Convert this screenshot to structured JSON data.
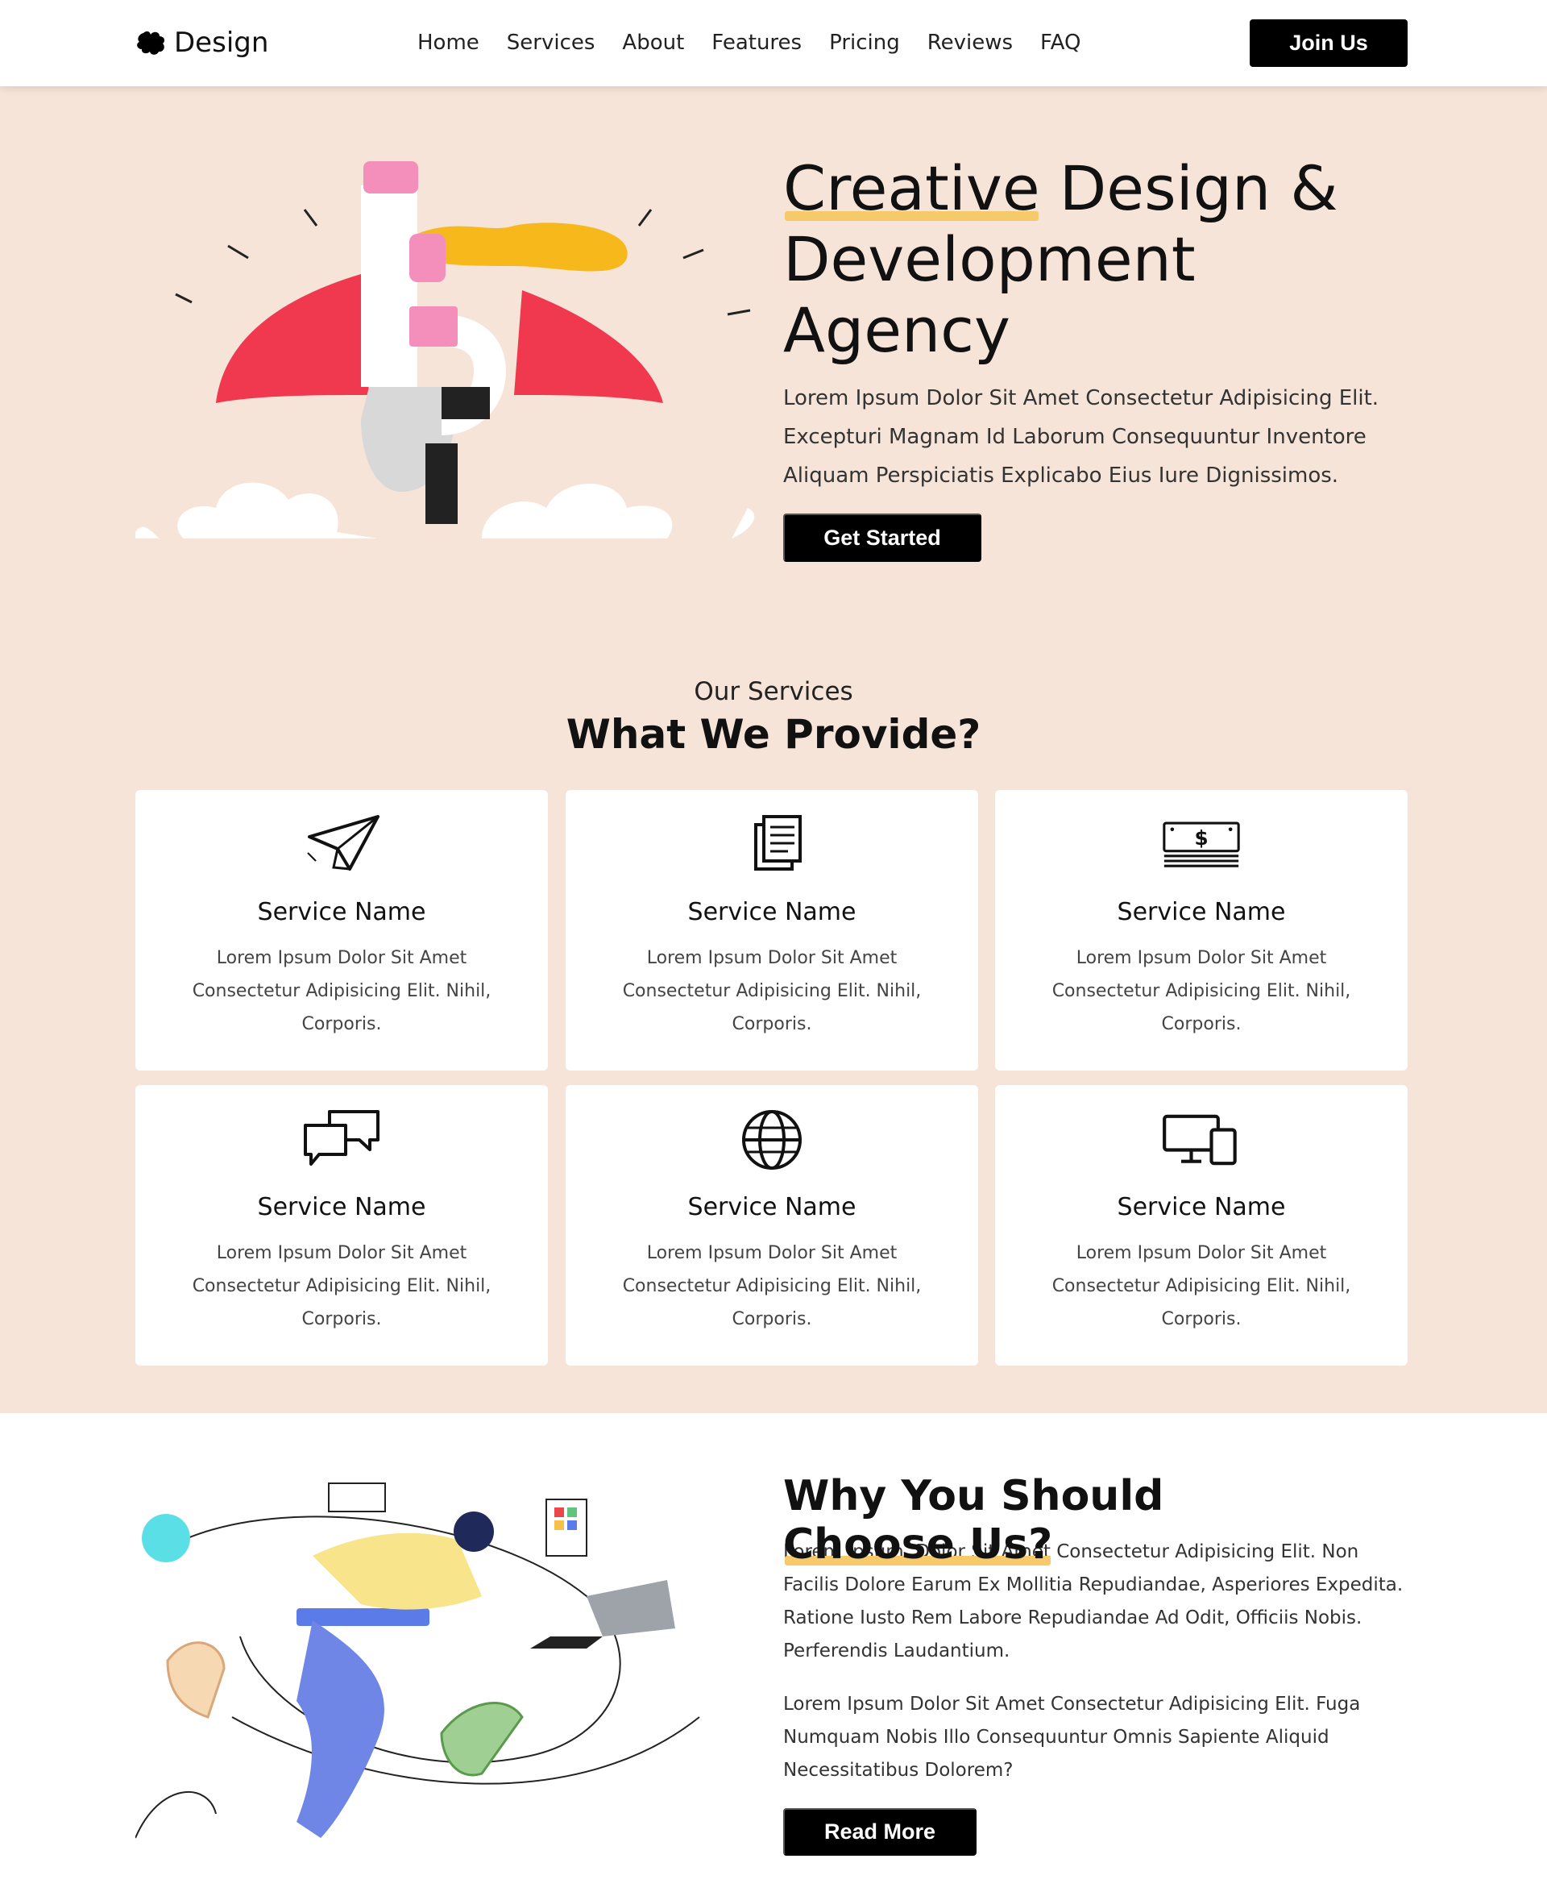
{
  "nav": {
    "logo_text": "Design",
    "links": [
      "Home",
      "Services",
      "About",
      "Features",
      "Pricing",
      "Reviews",
      "FAQ"
    ],
    "cta": "Join Us"
  },
  "hero": {
    "title_highlight": "Creative",
    "title_rest_1": " Design &",
    "title_line_2": "Development",
    "title_line_3": "Agency",
    "description": "Lorem Ipsum Dolor Sit Amet Consectetur Adipisicing Elit. Excepturi Magnam Id Laborum Consequuntur Inventore Aliquam Perspiciatis Explicabo Eius Iure Dignissimos.",
    "button": "Get Started"
  },
  "services": {
    "eyebrow": "Our Services",
    "title": "What We Provide?",
    "items": [
      {
        "icon": "paper-plane-icon",
        "name": "Service Name",
        "desc": "Lorem Ipsum Dolor Sit Amet Consectetur Adipisicing Elit. Nihil, Corporis."
      },
      {
        "icon": "documents-icon",
        "name": "Service Name",
        "desc": "Lorem Ipsum Dolor Sit Amet Consectetur Adipisicing Elit. Nihil, Corporis."
      },
      {
        "icon": "money-stack-icon",
        "name": "Service Name",
        "desc": "Lorem Ipsum Dolor Sit Amet Consectetur Adipisicing Elit. Nihil, Corporis."
      },
      {
        "icon": "chat-bubbles-icon",
        "name": "Service Name",
        "desc": "Lorem Ipsum Dolor Sit Amet Consectetur Adipisicing Elit. Nihil, Corporis."
      },
      {
        "icon": "globe-icon",
        "name": "Service Name",
        "desc": "Lorem Ipsum Dolor Sit Amet Consectetur Adipisicing Elit. Nihil, Corporis."
      },
      {
        "icon": "devices-icon",
        "name": "Service Name",
        "desc": "Lorem Ipsum Dolor Sit Amet Consectetur Adipisicing Elit. Nihil, Corporis."
      }
    ]
  },
  "why": {
    "title_plain": "Why You Should ",
    "title_highlight": "Choose Us?",
    "p1": "Lorem Ipsum, Dolor Sit Amet Consectetur Adipisicing Elit. Non Facilis Dolore Earum Ex Mollitia Repudiandae, Asperiores Expedita. Ratione Iusto Rem Labore Repudiandae Ad Odit, Officiis Nobis. Perferendis Laudantium.",
    "p2": "Lorem Ipsum Dolor Sit Amet Consectetur Adipisicing Elit. Fuga Numquam Nobis Illo Consequuntur Omnis Sapiente Aliquid Necessitatibus Dolorem?",
    "button": "Read More"
  },
  "colors": {
    "beige_background": "#f5e4d7",
    "highlight": "#f6c96b",
    "button": "#000000"
  }
}
